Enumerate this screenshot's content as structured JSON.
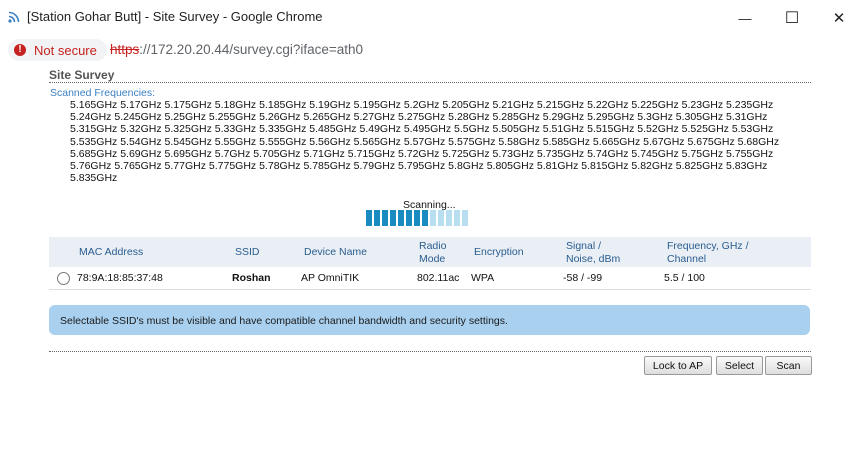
{
  "window": {
    "title": "[Station Gohar Butt] - Site Survey - Google Chrome",
    "minimize_glyph": "—",
    "maximize_glyph": "☐",
    "close_glyph": "✕"
  },
  "address_bar": {
    "security_label": "Not secure",
    "url_scheme": "https",
    "url_rest": "://172.20.20.44/survey.cgi?iface=ath0"
  },
  "page": {
    "heading": "Site Survey",
    "frequencies_label": "Scanned Frequencies:",
    "frequencies": "5.165GHz 5.17GHz 5.175GHz 5.18GHz 5.185GHz 5.19GHz 5.195GHz 5.2GHz 5.205GHz 5.21GHz 5.215GHz 5.22GHz 5.225GHz 5.23GHz 5.235GHz 5.24GHz 5.245GHz 5.25GHz 5.255GHz 5.26GHz 5.265GHz 5.27GHz 5.275GHz 5.28GHz 5.285GHz 5.29GHz 5.295GHz 5.3GHz 5.305GHz 5.31GHz 5.315GHz 5.32GHz 5.325GHz 5.33GHz 5.335GHz 5.485GHz 5.49GHz 5.495GHz 5.5GHz 5.505GHz 5.51GHz 5.515GHz 5.52GHz 5.525GHz 5.53GHz 5.535GHz 5.54GHz 5.545GHz 5.55GHz 5.555GHz 5.56GHz 5.565GHz 5.57GHz 5.575GHz 5.58GHz 5.585GHz 5.665GHz 5.67GHz 5.675GHz 5.68GHz 5.685GHz 5.69GHz 5.695GHz 5.7GHz 5.705GHz 5.71GHz 5.715GHz 5.72GHz 5.725GHz 5.73GHz 5.735GHz 5.74GHz 5.745GHz 5.75GHz 5.755GHz 5.76GHz 5.765GHz 5.77GHz 5.775GHz 5.78GHz 5.785GHz 5.79GHz 5.795GHz 5.8GHz 5.805GHz 5.81GHz 5.815GHz 5.82GHz 5.825GHz 5.83GHz 5.835GHz",
    "scanning_text": "Scanning...",
    "progress": {
      "filled_segments": 8,
      "total_segments": 13,
      "filled_color": "#1a8bc0",
      "empty_color": "#b8dff0"
    },
    "table": {
      "headers": {
        "mac": "MAC Address",
        "ssid": "SSID",
        "device": "Device Name",
        "radio_1": "Radio",
        "radio_2": "Mode",
        "encryption": "Encryption",
        "signal_1": "Signal /",
        "signal_2": "Noise, dBm",
        "freq_1": "Frequency, GHz /",
        "freq_2": "Channel"
      },
      "rows": [
        {
          "mac": "78:9A:18:85:37:48",
          "ssid": "Roshan",
          "device": "AP OmniTIK",
          "radio": "802.11ac",
          "encryption": "WPA",
          "signal": "-58 / -99",
          "frequency": "5.5 / 100"
        }
      ]
    },
    "info_message": "Selectable SSID's must be visible and have compatible channel bandwidth and security settings.",
    "buttons": {
      "lock": "Lock to AP",
      "select": "Select",
      "scan": "Scan"
    }
  },
  "colors": {
    "accent": "#3a7fc1",
    "info_bg": "#a9d0ee",
    "header_bg": "#e9eff5",
    "warning": "#c5221f"
  }
}
